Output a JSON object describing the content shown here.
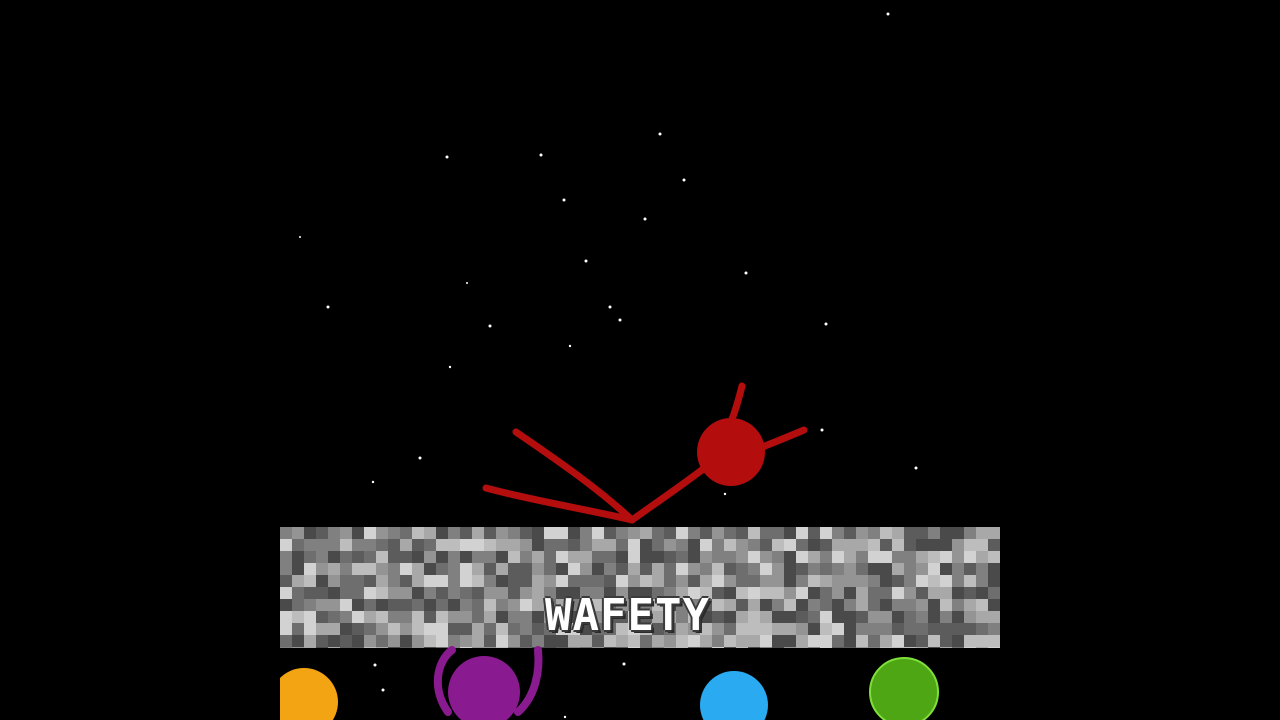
{
  "scene": {
    "platform_label": "WAFETY",
    "background_color": "#000000",
    "platform_color": "#808080"
  },
  "characters": [
    {
      "name": "red-stickman",
      "color": "#b30d0d",
      "pose": "lying-on-platform"
    },
    {
      "name": "orange-stickman",
      "color": "#f2a413",
      "pose": "peeking"
    },
    {
      "name": "purple-stickman",
      "color": "#8a1a8f",
      "pose": "arms-raised"
    },
    {
      "name": "blue-stickman",
      "color": "#2aaaf0",
      "pose": "peeking"
    },
    {
      "name": "green-stickman",
      "color": "#4ea614",
      "pose": "peeking"
    }
  ]
}
